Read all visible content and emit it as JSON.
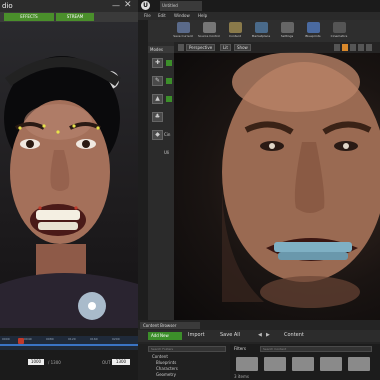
{
  "capture": {
    "title": "dio",
    "minimize": "—",
    "close": "✕",
    "tabs": [
      "EFFECTS",
      "STREAM"
    ],
    "ruler_ticks": [
      "0000",
      "0040",
      "0080",
      "0120",
      "0160",
      "0200"
    ],
    "frame_value": "1000",
    "frame_total": "/ 1300",
    "out_label": "OUT",
    "out_value": "1300"
  },
  "editor": {
    "logo": "U",
    "level_tab": "Untitled",
    "menu": [
      "File",
      "Edit",
      "Window",
      "Help"
    ],
    "toolbar": [
      {
        "label": "Save Current",
        "icon": "save-icon",
        "color": "#5a6a8a"
      },
      {
        "label": "Source Control",
        "icon": "source-control-icon",
        "color": "#777"
      },
      {
        "label": "Content",
        "icon": "content-icon",
        "color": "#8a7a4a"
      },
      {
        "label": "Marketplace",
        "icon": "marketplace-icon",
        "color": "#4a6a8a"
      },
      {
        "label": "Settings",
        "icon": "settings-icon",
        "color": "#666"
      },
      {
        "label": "Blueprints",
        "icon": "blueprints-icon",
        "color": "#4a6aa0"
      },
      {
        "label": "Cinematics",
        "icon": "cinematics-icon",
        "color": "#555"
      }
    ],
    "modes_tab": "Modes",
    "modes": [
      {
        "icon": "place-mode-icon",
        "glyph": "✚"
      },
      {
        "icon": "paint-mode-icon",
        "glyph": "✎"
      },
      {
        "icon": "landscape-mode-icon",
        "glyph": "▲"
      },
      {
        "icon": "foliage-mode-icon",
        "glyph": "♣"
      },
      {
        "icon": "geometry-mode-icon",
        "glyph": "◆"
      }
    ],
    "modes_labels": [
      "Cin",
      "Uli"
    ],
    "viewport": {
      "perspective": "Perspective",
      "lit": "Lit",
      "show": "Show"
    },
    "content_browser": {
      "tab": "Content Browser",
      "add_new": "Add New",
      "import": "Import",
      "save_all": "Save All",
      "path": "Content",
      "tree_search_placeholder": "Search Folders",
      "tree": [
        "Content",
        "Blueprints",
        "Characters",
        "Geometry"
      ],
      "filters": "Filters",
      "asset_search_placeholder": "Search Content",
      "item_count": "3 items"
    }
  }
}
